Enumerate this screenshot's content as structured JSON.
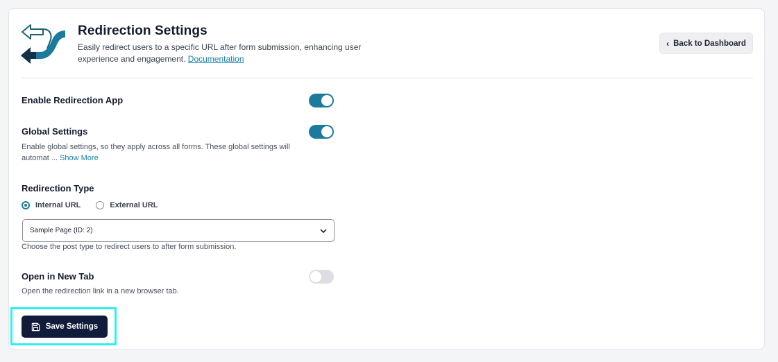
{
  "header": {
    "title": "Redirection Settings",
    "description": "Easily redirect users to a specific URL after form submission, enhancing user experience and engagement.",
    "doc_link": "Documentation",
    "back_button": "Back to Dashboard",
    "logo_icon": "redirect-arrows-icon"
  },
  "settings": {
    "enable_app": {
      "label": "Enable Redirection App",
      "enabled": true
    },
    "global": {
      "label": "Global Settings",
      "desc_line1": "Enable global settings, so they apply across all forms. These global settings will",
      "desc_line2": "automat ...",
      "show_more": "Show More",
      "enabled": true
    },
    "redirection_type": {
      "label": "Redirection Type",
      "options": [
        "Internal URL",
        "External URL"
      ],
      "selected": "Internal URL",
      "select_value": "Sample Page (ID: 2)",
      "helper": "Choose the post type to redirect users to after form submission."
    },
    "new_tab": {
      "label": "Open in New Tab",
      "desc": "Open the redirection link in a new browser tab.",
      "enabled": false
    }
  },
  "footer": {
    "save_button": "Save Settings"
  },
  "colors": {
    "accent": "#1a7b9c",
    "primary_button": "#111b3a",
    "highlight": "#2ef0f0"
  }
}
